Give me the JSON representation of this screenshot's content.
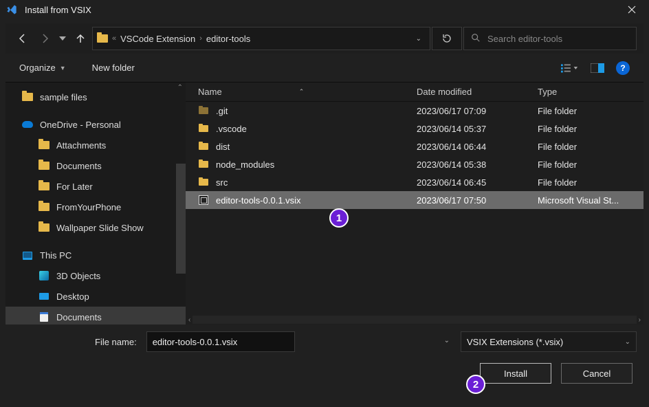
{
  "title": "Install from VSIX",
  "breadcrumb": {
    "sep_first": "«",
    "l1": "VSCode Extension",
    "l2": "editor-tools"
  },
  "nav": {
    "refresh_title": "Refresh"
  },
  "search": {
    "placeholder": "Search editor-tools"
  },
  "cmd": {
    "organize": "Organize",
    "new_folder": "New folder"
  },
  "sidebar": {
    "items": [
      {
        "label": "sample files",
        "type": "folder",
        "indent": "root"
      },
      {
        "label": "OneDrive - Personal",
        "type": "onedrive",
        "indent": "root"
      },
      {
        "label": "Attachments",
        "type": "folder",
        "indent": "sub"
      },
      {
        "label": "Documents",
        "type": "folder",
        "indent": "sub"
      },
      {
        "label": "For Later",
        "type": "folder",
        "indent": "sub"
      },
      {
        "label": "FromYourPhone",
        "type": "folder",
        "indent": "sub"
      },
      {
        "label": "Wallpaper Slide Show",
        "type": "folder",
        "indent": "sub"
      },
      {
        "label": "This PC",
        "type": "thispc",
        "indent": "root"
      },
      {
        "label": "3D Objects",
        "type": "obj3d",
        "indent": "sub"
      },
      {
        "label": "Desktop",
        "type": "desktop",
        "indent": "sub"
      },
      {
        "label": "Documents",
        "type": "doc",
        "indent": "sub",
        "selected": true
      }
    ]
  },
  "columns": {
    "name": "Name",
    "date": "Date modified",
    "type": "Type"
  },
  "files": [
    {
      "name": ".git",
      "date": "2023/06/17 07:09",
      "type": "File folder",
      "icon": "folder",
      "hidden": true
    },
    {
      "name": ".vscode",
      "date": "2023/06/14 05:37",
      "type": "File folder",
      "icon": "folder"
    },
    {
      "name": "dist",
      "date": "2023/06/14 06:44",
      "type": "File folder",
      "icon": "folder"
    },
    {
      "name": "node_modules",
      "date": "2023/06/14 05:38",
      "type": "File folder",
      "icon": "folder"
    },
    {
      "name": "src",
      "date": "2023/06/14 06:45",
      "type": "File folder",
      "icon": "folder"
    },
    {
      "name": "editor-tools-0.0.1.vsix",
      "date": "2023/06/17 07:50",
      "type": "Microsoft Visual St...",
      "icon": "vsix",
      "selected": true
    }
  ],
  "footer": {
    "filename_label": "File name:",
    "filename_value": "editor-tools-0.0.1.vsix",
    "filter_label": "VSIX Extensions (*.vsix)",
    "install": "Install",
    "cancel": "Cancel"
  },
  "annotations": {
    "one": "1",
    "two": "2"
  }
}
